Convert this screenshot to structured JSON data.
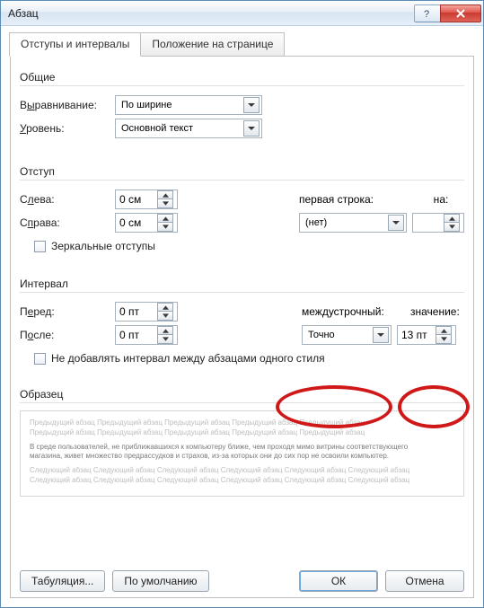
{
  "window": {
    "title": "Абзац"
  },
  "tabs": {
    "indents": "Отступы и интервалы",
    "position": "Положение на странице"
  },
  "groups": {
    "general": "Общие",
    "indent": "Отступ",
    "spacing": "Интервал",
    "preview": "Образец"
  },
  "general": {
    "alignment_lbl_pre": "В",
    "alignment_lbl_u": "ы",
    "alignment_lbl_post": "равнивание:",
    "alignment_val": "По ширине",
    "level_lbl_pre": "",
    "level_lbl_u": "У",
    "level_lbl_post": "ровень:",
    "level_val": "Основной текст"
  },
  "indent": {
    "left_lbl_pre": "С",
    "left_lbl_u": "л",
    "left_lbl_post": "ева:",
    "left_val": "0 см",
    "right_lbl_pre": "С",
    "right_lbl_u": "п",
    "right_lbl_post": "рава:",
    "right_val": "0 см",
    "first_line_lbl": "перва",
    "first_line_u": "я",
    "first_line_post": " строка:",
    "on_lbl_u": "н",
    "on_lbl_post": "а:",
    "special_val": "(нет)",
    "by_val": "",
    "mirror_chk": "Зеркальные отступы"
  },
  "spacing": {
    "before_lbl_pre": "П",
    "before_lbl_u": "е",
    "before_lbl_post": "ред:",
    "before_val": "0 пт",
    "after_lbl_pre": "П",
    "after_lbl_u": "о",
    "after_lbl_post": "сле:",
    "after_val": "0 пт",
    "line_lbl_u": "м",
    "line_lbl_post": "еждустрочный:",
    "line_val": "Точно",
    "at_lbl_u": "з",
    "at_lbl_post": "начение:",
    "at_val": "13 пт",
    "noadd_chk": "Не добавлять интервал между абзацами одного стиля"
  },
  "preview": {
    "grey_line": "Предыдущий абзац Предыдущий абзац Предыдущий абзац Предыдущий абзац Предыдущий абзац",
    "grey_line2": "Предыдущий абзац Предыдущий абзац Предыдущий абзац Предыдущий абзац Предыдущий абзац",
    "dark_line1": "В среде пользователей, не приближавшихся к компьютеру ближе, чем проходя мимо витрины соответствующего",
    "dark_line2": "магазина, живет множество предрассудков и страхов, из-за которых они до сих пор не освоили компьютер.",
    "grey_line3": "Следующий абзац Следующий абзац Следующий абзац Следующий абзац Следующий абзац Следующий абзац",
    "grey_line4": "Следующий абзац Следующий абзац Следующий абзац Следующий абзац Следующий абзац Следующий абзац"
  },
  "buttons": {
    "tabs": "Табуляция...",
    "default": "По умолчанию",
    "ok": "ОК",
    "cancel": "Отмена"
  }
}
